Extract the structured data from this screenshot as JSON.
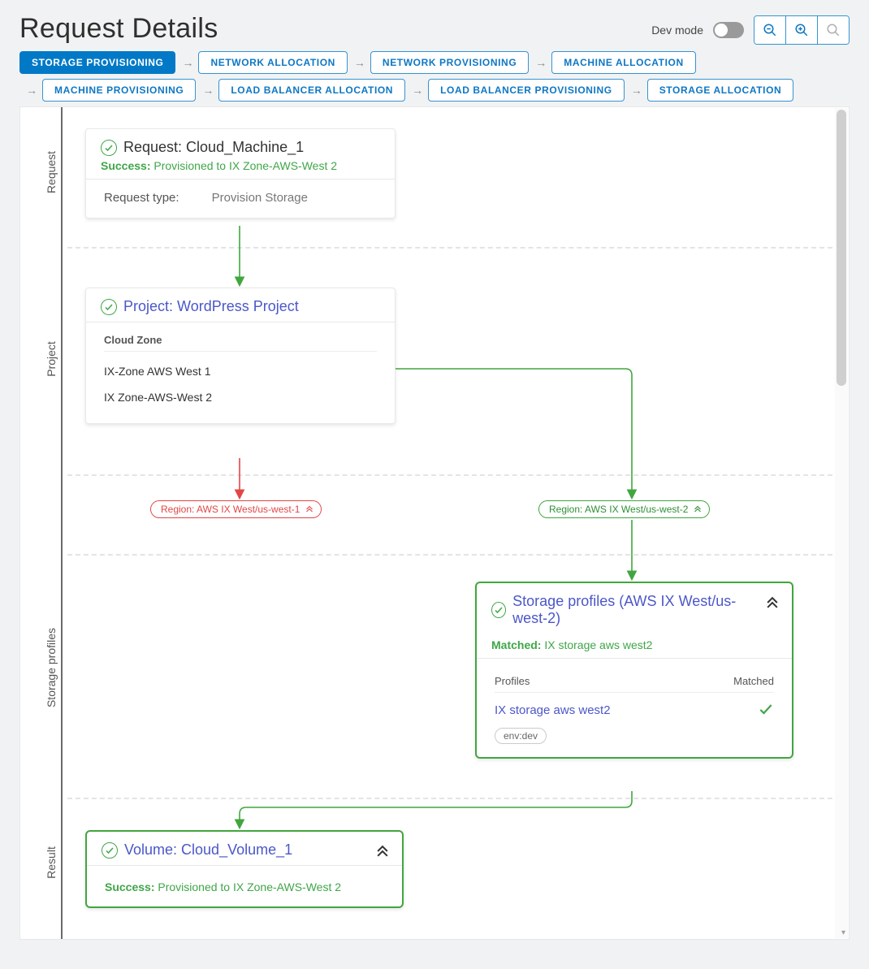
{
  "page": {
    "title": "Request Details"
  },
  "dev_mode": {
    "label": "Dev mode",
    "on": false
  },
  "stages": [
    {
      "label": "STORAGE PROVISIONING",
      "active": true
    },
    {
      "label": "NETWORK ALLOCATION"
    },
    {
      "label": "NETWORK PROVISIONING"
    },
    {
      "label": "MACHINE ALLOCATION"
    },
    {
      "label": "MACHINE PROVISIONING"
    },
    {
      "label": "LOAD BALANCER ALLOCATION"
    },
    {
      "label": "LOAD BALANCER PROVISIONING"
    },
    {
      "label": "STORAGE ALLOCATION"
    }
  ],
  "lanes": [
    "Request",
    "Project",
    "Storage profiles",
    "Result"
  ],
  "request_card": {
    "title": "Request: Cloud_Machine_1",
    "status_label": "Success:",
    "status_text": "Provisioned to IX Zone-AWS-West 2",
    "type_label": "Request type:",
    "type_value": "Provision Storage"
  },
  "project_card": {
    "title": "Project: WordPress Project",
    "zones_label": "Cloud Zone",
    "zones": [
      "IX-Zone AWS West 1",
      "IX Zone-AWS-West 2"
    ]
  },
  "regions": {
    "left": {
      "label": "Region: AWS IX West/us-west-1",
      "status": "fail"
    },
    "right": {
      "label": "Region: AWS IX West/us-west-2",
      "status": "ok"
    }
  },
  "storage_profiles_card": {
    "title": "Storage profiles (AWS IX West/us-west-2)",
    "matched_label": "Matched:",
    "matched_value": "IX storage aws west2",
    "col_profiles": "Profiles",
    "col_matched": "Matched",
    "rows": [
      {
        "name": "IX storage aws west2",
        "matched": true,
        "tags": [
          "env:dev"
        ]
      }
    ]
  },
  "result_card": {
    "title": "Volume: Cloud_Volume_1",
    "status_label": "Success:",
    "status_text": "Provisioned to IX Zone-AWS-West 2"
  }
}
